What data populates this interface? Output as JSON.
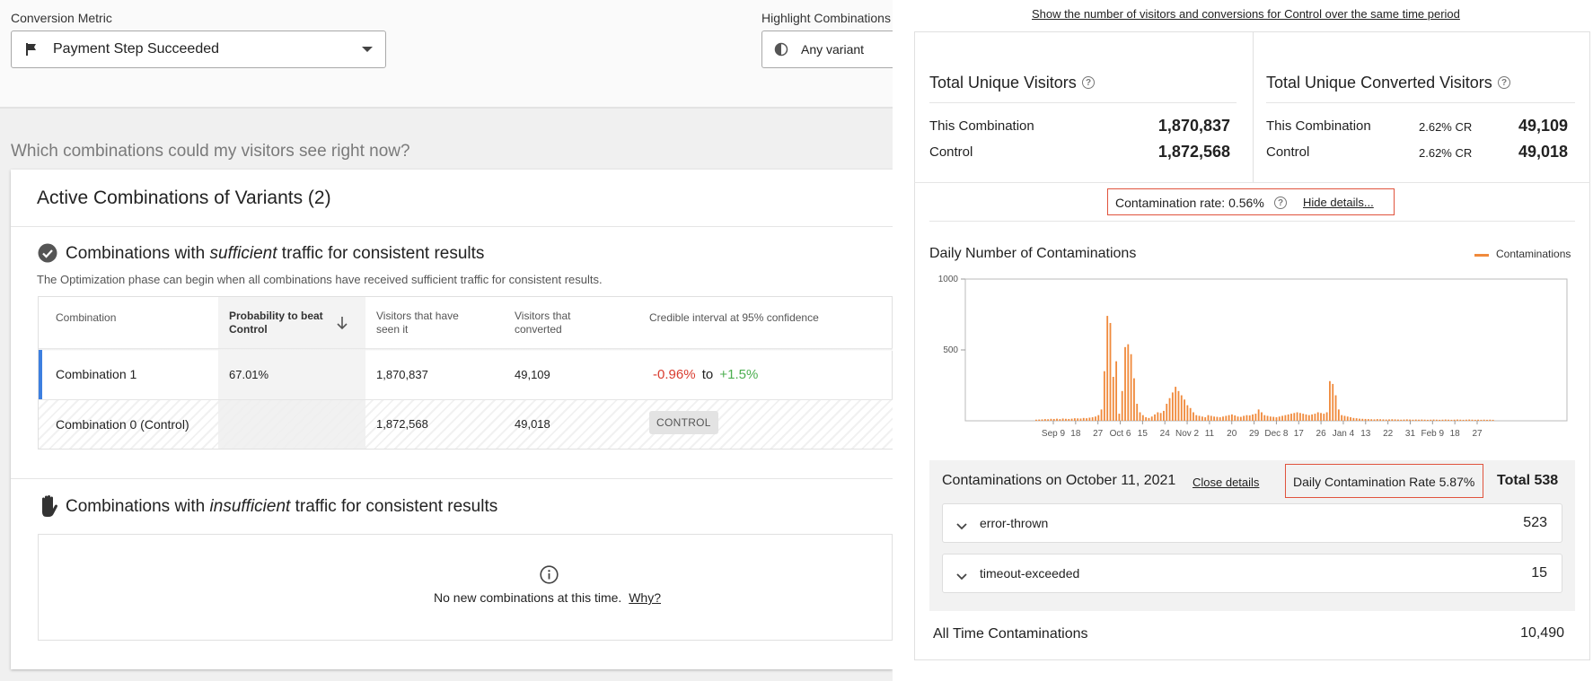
{
  "conversion_metric": {
    "label": "Conversion Metric",
    "value": "Payment Step Succeeded"
  },
  "highlight": {
    "label": "Highlight Combinations",
    "value": "Any variant"
  },
  "question": "Which combinations could my visitors see right now?",
  "card": {
    "title": "Active Combinations of Variants (2)",
    "sufficient": {
      "prefix": "Combinations with ",
      "emph": "sufficient",
      "suffix": " traffic for consistent results",
      "subtitle": "The Optimization phase can begin when all combinations have received sufficient traffic for consistent results."
    },
    "table": {
      "headers": {
        "combination": "Combination",
        "prob_line1": "Probability to beat",
        "prob_line2": "Control",
        "seen_line1": "Visitors that have",
        "seen_line2": "seen it",
        "conv_line1": "Visitors that",
        "conv_line2": "converted",
        "ci": "Credible interval at 95% confidence"
      },
      "rows": [
        {
          "name": "Combination 1",
          "prob": "67.01%",
          "seen": "1,870,837",
          "converted": "49,109",
          "ci_low": "-0.96%",
          "ci_to": "to",
          "ci_high": "+1.5%"
        },
        {
          "name": "Combination 0 (Control)",
          "prob": "",
          "seen": "1,872,568",
          "converted": "49,018",
          "chip": "CONTROL"
        }
      ]
    },
    "insufficient": {
      "prefix": "Combinations with ",
      "emph": "insufficient",
      "suffix": " traffic for consistent results",
      "empty_text": "No new combinations at this time.",
      "why": "Why?"
    }
  },
  "right": {
    "top_link": "Show the number of visitors and conversions for Control over the same time period",
    "visitors": {
      "title": "Total Unique Visitors",
      "rows": [
        {
          "label": "This Combination",
          "value": "1,870,837"
        },
        {
          "label": "Control",
          "value": "1,872,568"
        }
      ]
    },
    "converted": {
      "title": "Total Unique Converted Visitors",
      "rows": [
        {
          "label": "This Combination",
          "cr": "2.62% CR",
          "value": "49,109"
        },
        {
          "label": "Control",
          "cr": "2.62% CR",
          "value": "49,018"
        }
      ]
    },
    "contamination_rate": "Contamination rate: 0.56%",
    "hide_details": "Hide details...",
    "chart_title": "Daily Number of Contaminations",
    "legend": "Contaminations",
    "details": {
      "title": "Contaminations on October 11, 2021",
      "close": "Close details",
      "daily_rate": "Daily Contamination Rate 5.87%",
      "total": "Total 538",
      "items": [
        {
          "label": "error-thrown",
          "value": "523"
        },
        {
          "label": "timeout-exceeded",
          "value": "15"
        }
      ]
    },
    "all_time": {
      "label": "All Time Contaminations",
      "value": "10,490"
    }
  },
  "chart_data": {
    "type": "bar",
    "title": "Daily Number of Contaminations",
    "series": [
      {
        "name": "Contaminations",
        "color": "#f08a3c"
      }
    ],
    "ylim": [
      0,
      1000
    ],
    "y_ticks": [
      "500",
      "1000"
    ],
    "x_ticks": [
      "Sep 9",
      "18",
      "27",
      "Oct 6",
      "15",
      "24",
      "Nov 2",
      "11",
      "20",
      "29",
      "Dec 8",
      "17",
      "26",
      "Jan 4",
      "13",
      "22",
      "31",
      "Feb 9",
      "18",
      "27"
    ],
    "values": [
      8,
      9,
      10,
      12,
      11,
      14,
      13,
      15,
      12,
      16,
      14,
      13,
      15,
      18,
      17,
      16,
      20,
      18,
      22,
      25,
      30,
      40,
      80,
      350,
      740,
      690,
      310,
      420,
      50,
      210,
      520,
      540,
      470,
      300,
      120,
      60,
      40,
      25,
      20,
      30,
      45,
      60,
      55,
      70,
      120,
      160,
      200,
      240,
      210,
      180,
      150,
      110,
      90,
      60,
      40,
      35,
      30,
      25,
      40,
      35,
      30,
      28,
      25,
      30,
      35,
      40,
      45,
      38,
      30,
      28,
      35,
      40,
      38,
      45,
      50,
      80,
      60,
      40,
      35,
      30,
      28,
      25,
      30,
      35,
      40,
      45,
      50,
      55,
      60,
      55,
      50,
      45,
      40,
      45,
      50,
      60,
      55,
      50,
      60,
      280,
      260,
      180,
      80,
      40,
      35,
      30,
      25,
      20,
      18,
      15,
      14,
      13,
      12,
      11,
      10,
      12,
      11,
      10,
      9,
      10,
      11,
      10,
      9,
      8,
      9,
      10,
      9,
      8,
      9,
      8,
      9,
      8,
      7,
      8,
      9,
      8,
      7,
      8,
      9,
      8,
      7,
      8,
      9,
      8,
      7,
      8,
      9,
      8,
      7,
      8,
      7,
      8,
      7,
      8,
      7
    ]
  }
}
